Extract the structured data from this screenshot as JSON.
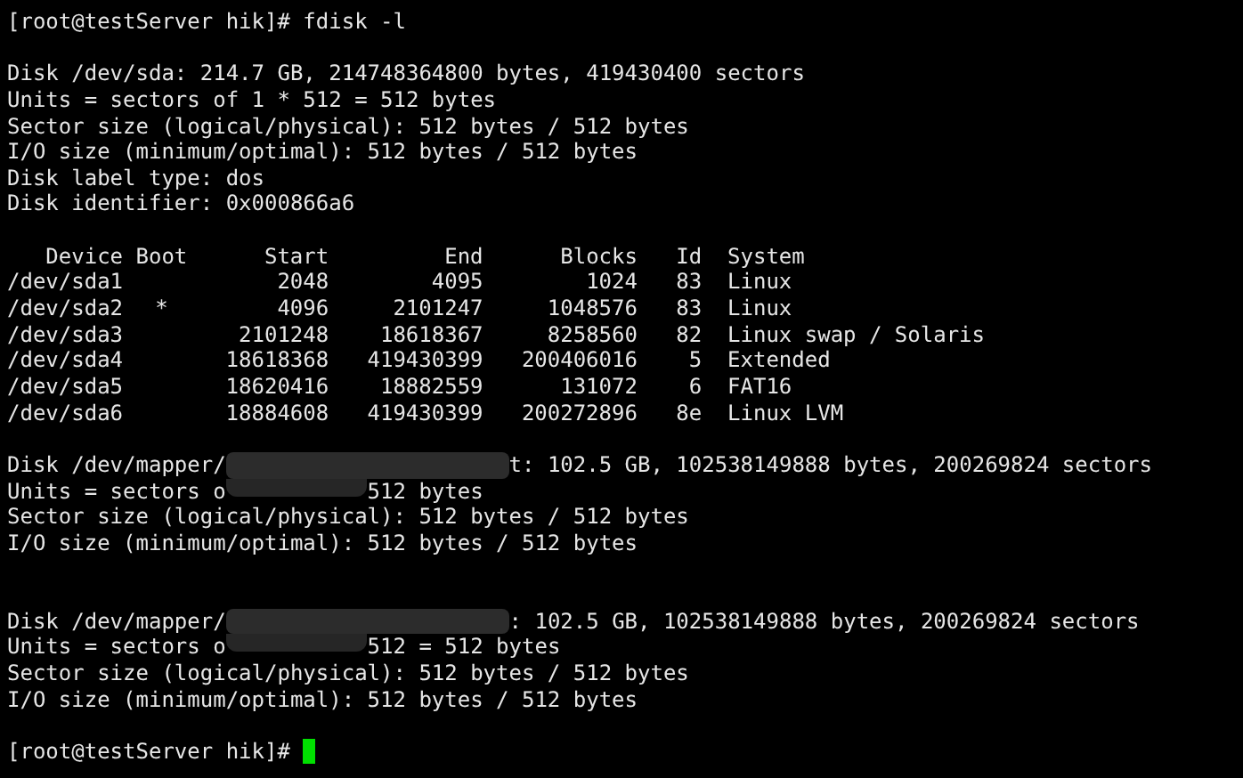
{
  "terminal": {
    "lines": [
      {
        "kind": "prompt",
        "text": "[root@testServer hik]# fdisk -l",
        "cursor": false
      },
      {
        "kind": "blank"
      },
      {
        "kind": "text",
        "text": "Disk /dev/sda: 214.7 GB, 214748364800 bytes, 419430400 sectors"
      },
      {
        "kind": "text",
        "text": "Units = sectors of 1 * 512 = 512 bytes"
      },
      {
        "kind": "text",
        "text": "Sector size (logical/physical): 512 bytes / 512 bytes"
      },
      {
        "kind": "text",
        "text": "I/O size (minimum/optimal): 512 bytes / 512 bytes"
      },
      {
        "kind": "text",
        "text": "Disk label type: dos"
      },
      {
        "kind": "text",
        "text": "Disk identifier: 0x000866a6"
      },
      {
        "kind": "blank"
      },
      {
        "kind": "table_header",
        "device": "Device Boot",
        "start": "Start",
        "end": "End",
        "blocks": "Blocks",
        "id": "Id",
        "system": "System"
      },
      {
        "kind": "table_row",
        "device": "/dev/sda1",
        "start": "2048",
        "end": "4095",
        "blocks": "1024",
        "id": "83",
        "system": "Linux"
      },
      {
        "kind": "table_row",
        "device": "/dev/sda2",
        "boot": "*",
        "start": "4096",
        "end": "2101247",
        "blocks": "1048576",
        "id": "83",
        "system": "Linux"
      },
      {
        "kind": "table_row",
        "device": "/dev/sda3",
        "start": "2101248",
        "end": "18618367",
        "blocks": "8258560",
        "id": "82",
        "system": "Linux swap / Solaris"
      },
      {
        "kind": "table_row",
        "device": "/dev/sda4",
        "start": "18618368",
        "end": "419430399",
        "blocks": "200406016",
        "id": "5",
        "system": "Extended"
      },
      {
        "kind": "table_row",
        "device": "/dev/sda5",
        "start": "18620416",
        "end": "18882559",
        "blocks": "131072",
        "id": "6",
        "system": "FAT16"
      },
      {
        "kind": "table_row",
        "device": "/dev/sda6",
        "start": "18884608",
        "end": "419430399",
        "blocks": "200272896",
        "id": "8e",
        "system": "Linux LVM"
      },
      {
        "kind": "blank"
      },
      {
        "kind": "segments",
        "parts": [
          {
            "kind": "text",
            "text": "Disk /dev/mapper/"
          },
          {
            "kind": "redaction"
          },
          {
            "kind": "text",
            "text": "t: 102.5 GB, 102538149888 bytes, 200269824 sectors"
          }
        ]
      },
      {
        "kind": "segments",
        "parts": [
          {
            "kind": "text",
            "text": "Units = sectors o"
          },
          {
            "kind": "redaction_tail"
          },
          {
            "kind": "text",
            "text": "512 bytes"
          }
        ]
      },
      {
        "kind": "text",
        "text": "Sector size (logical/physical): 512 bytes / 512 bytes"
      },
      {
        "kind": "text",
        "text": "I/O size (minimum/optimal): 512 bytes / 512 bytes"
      },
      {
        "kind": "blank"
      },
      {
        "kind": "blank"
      },
      {
        "kind": "segments",
        "parts": [
          {
            "kind": "text",
            "text": "Disk /dev/mapper/"
          },
          {
            "kind": "redaction"
          },
          {
            "kind": "text",
            "text": ": 102.5 GB, 102538149888 bytes, 200269824 sectors"
          }
        ]
      },
      {
        "kind": "segments",
        "parts": [
          {
            "kind": "text",
            "text": "Units = sectors o"
          },
          {
            "kind": "redaction_tail"
          },
          {
            "kind": "text",
            "text": "512 = 512 bytes"
          }
        ]
      },
      {
        "kind": "text",
        "text": "Sector size (logical/physical): 512 bytes / 512 bytes"
      },
      {
        "kind": "text",
        "text": "I/O size (minimum/optimal): 512 bytes / 512 bytes"
      },
      {
        "kind": "blank"
      },
      {
        "kind": "prompt",
        "text": "[root@testServer hik]#",
        "cursor": true
      }
    ]
  }
}
